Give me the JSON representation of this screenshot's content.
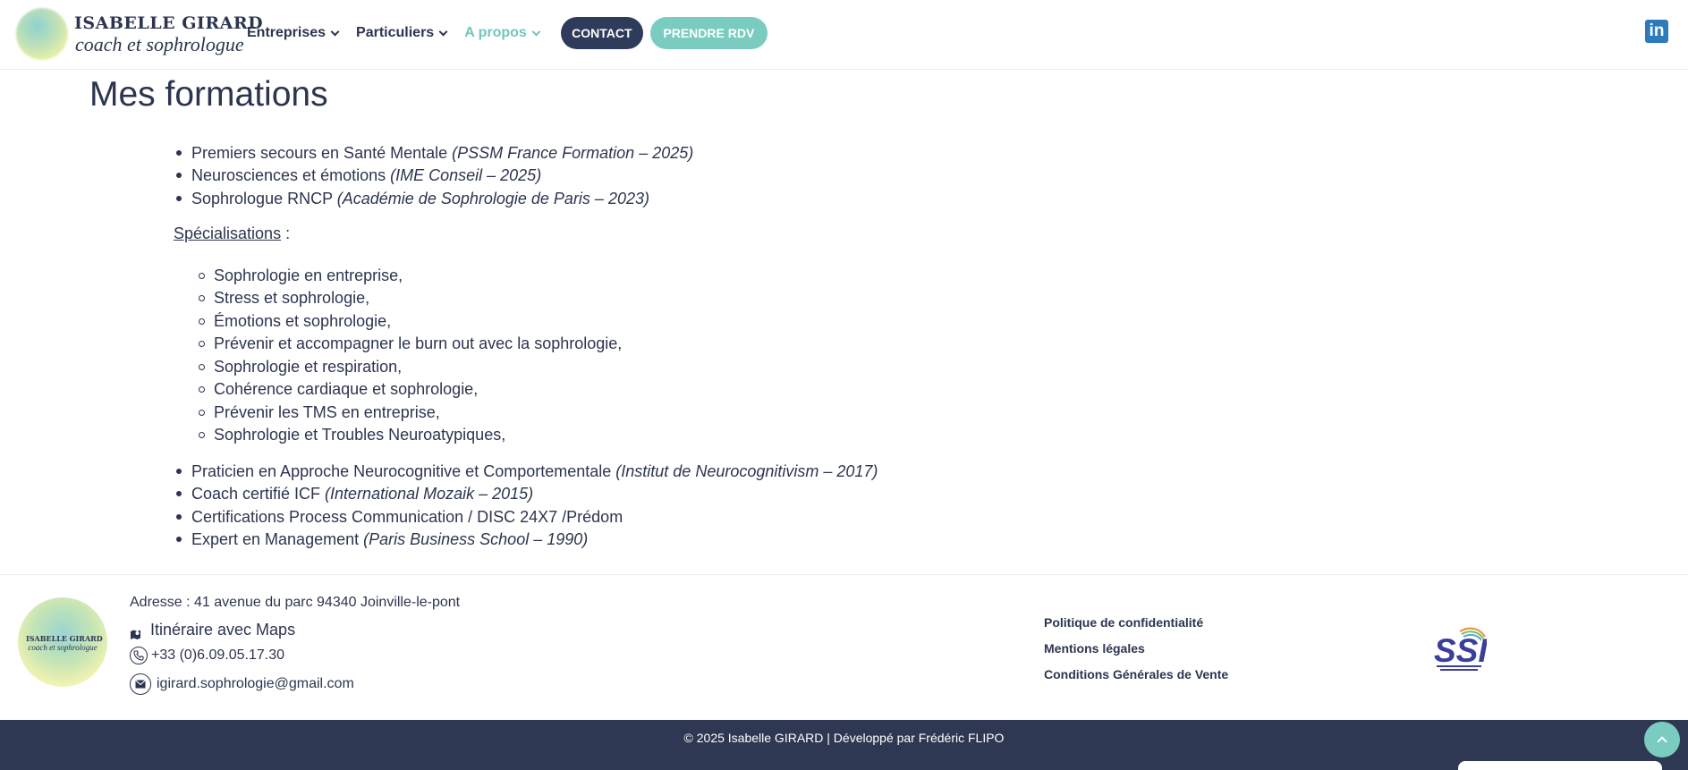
{
  "header": {
    "logo_name": "ISABELLE GIRARD",
    "logo_sub": "coach et sophrologue",
    "nav": [
      {
        "label": "Entreprises"
      },
      {
        "label": "Particuliers"
      },
      {
        "label": "A propos"
      }
    ],
    "contact_label": "CONTACT",
    "rdv_label": "PRENDRE RDV",
    "linkedin_glyph": "in"
  },
  "main": {
    "title": "Mes formations",
    "formations_top": [
      {
        "text": "Premiers secours en Santé Mentale ",
        "detail": "(PSSM France Formation – 2025)"
      },
      {
        "text": "Neurosciences et émotions ",
        "detail": "(IME Conseil – 2025)"
      },
      {
        "text": "Sophrologue RNCP ",
        "detail": "(Académie de Sophrologie de Paris – 2023)"
      }
    ],
    "specialisations_label": "Spécialisations",
    "specialisations_suffix": " :",
    "specialisations": [
      "Sophrologie en entreprise,",
      "Stress et sophrologie,",
      "Émotions et sophrologie,",
      "Prévenir et accompagner le burn out avec la sophrologie,",
      "Sophrologie et respiration,",
      "Cohérence cardiaque et sophrologie,",
      "Prévenir les TMS en entreprise,",
      "Sophrologie et Troubles Neuroatypiques,"
    ],
    "formations_bottom": [
      {
        "text": "Praticien en Approche Neurocognitive et Comportementale ",
        "detail": "(Institut de Neurocognitivism – 2017)"
      },
      {
        "text": "Coach certifié ICF ",
        "detail": "(International Mozaik – 2015)"
      },
      {
        "text": "Certifications Process Communication / DISC 24X7 /Prédom",
        "detail": ""
      },
      {
        "text": "Expert en Management ",
        "detail": "(Paris Business School – 1990)"
      }
    ]
  },
  "footer": {
    "logo_name": "ISABELLE GIRARD",
    "logo_sub": "coach et sophrologue",
    "address": "Adresse : 41 avenue du parc 94340 Joinville-le-pont",
    "maps_label": "Itinéraire avec Maps",
    "phone": "+33 (0)6.09.05.17.30",
    "email": "igirard.sophrologie@gmail.com",
    "links": [
      "Politique de confidentialité",
      "Mentions légales",
      "Conditions Générales de Vente"
    ],
    "ssi_text": "SSI",
    "copyright": "© 2025 Isabelle GIRARD | Développé par Frédéric FLIPO"
  },
  "colors": {
    "navy": "#2f3b5a",
    "teal": "#7acbc0",
    "text": "#2c3550",
    "linkedin": "#2d7bbd"
  },
  "icons": [
    "chevron-down-icon",
    "linkedin-icon",
    "map-icon",
    "phone-icon",
    "mail-icon",
    "chevron-up-icon"
  ]
}
